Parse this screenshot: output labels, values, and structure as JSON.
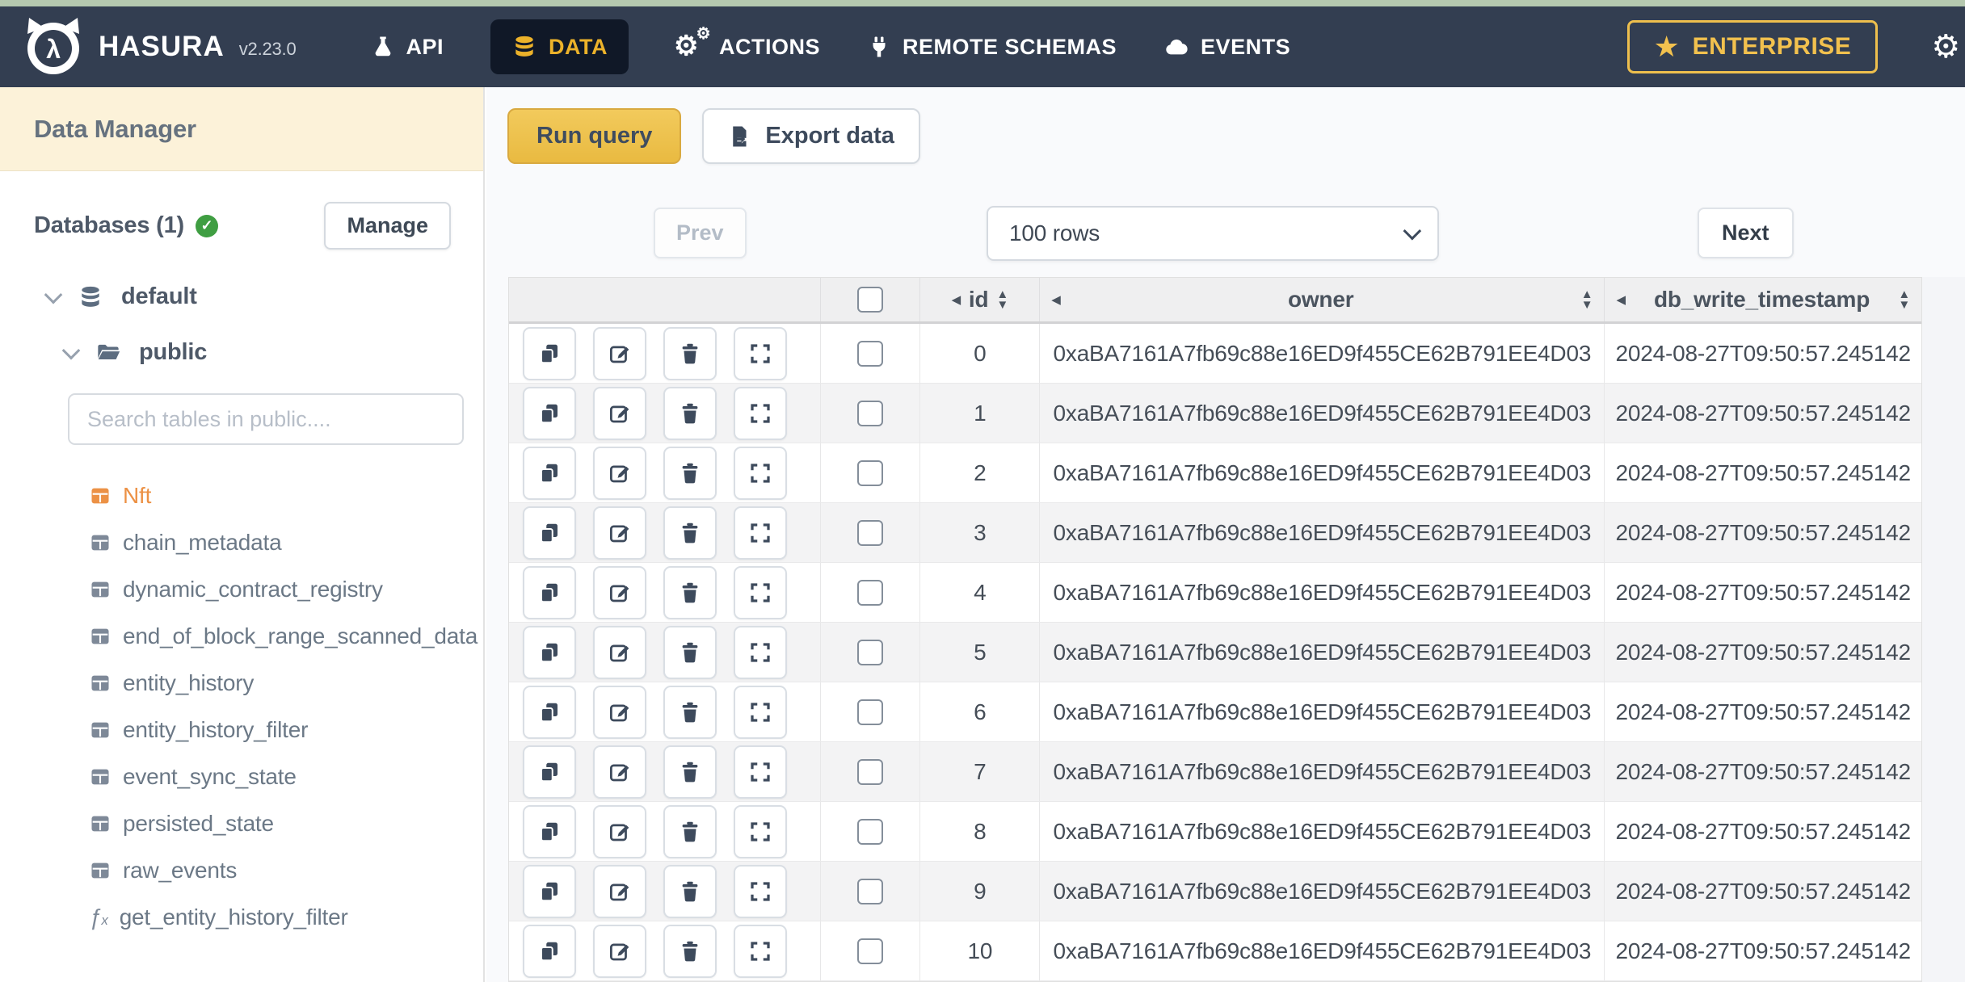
{
  "colors": {
    "top_strip_green": "#b5c8af",
    "topbar_bg": "#333e51",
    "active_tab_bg": "#101827",
    "active_tab_text": "#ecb22a",
    "enterprise_gold": "#f2c14e",
    "sidebar_header_bg": "#fcf2d9",
    "selected_table_orange": "#ec9145",
    "run_query_amber": "#eec252",
    "green_check": "#3f9e42",
    "table_stripe": "#f3f3f4"
  },
  "topbar": {
    "brand": {
      "name": "HASURA",
      "version": "v2.23.0"
    },
    "nav": [
      {
        "label": "API",
        "icon": "flask-icon",
        "active": false
      },
      {
        "label": "DATA",
        "icon": "database-icon",
        "active": true
      },
      {
        "label": "ACTIONS",
        "icon": "gears-icon",
        "active": false
      },
      {
        "label": "REMOTE SCHEMAS",
        "icon": "plug-icon",
        "active": false
      },
      {
        "label": "EVENTS",
        "icon": "cloud-icon",
        "active": false
      }
    ],
    "enterprise_label": "ENTERPRISE"
  },
  "sidebar": {
    "title": "Data Manager",
    "databases_label": "Databases (1)",
    "manage_button": "Manage",
    "tree": {
      "database": "default",
      "schema": "public"
    },
    "search_placeholder": "Search tables in public....",
    "tables": [
      {
        "name": "Nft",
        "selected": true
      },
      {
        "name": "chain_metadata",
        "selected": false
      },
      {
        "name": "dynamic_contract_registry",
        "selected": false
      },
      {
        "name": "end_of_block_range_scanned_data",
        "selected": false
      },
      {
        "name": "entity_history",
        "selected": false
      },
      {
        "name": "entity_history_filter",
        "selected": false
      },
      {
        "name": "event_sync_state",
        "selected": false
      },
      {
        "name": "persisted_state",
        "selected": false
      },
      {
        "name": "raw_events",
        "selected": false
      }
    ],
    "function_item": {
      "name": "get_entity_history_filter"
    }
  },
  "toolbar": {
    "run_query_label": "Run query",
    "export_data_label": "Export data"
  },
  "pagination": {
    "prev_label": "Prev",
    "page_size_value": "100 rows",
    "next_label": "Next"
  },
  "table": {
    "columns": [
      {
        "key": "id",
        "label": "id"
      },
      {
        "key": "owner",
        "label": "owner"
      },
      {
        "key": "db_write_timestamp",
        "label": "db_write_timestamp"
      }
    ],
    "rows": [
      {
        "id": "0",
        "owner": "0xaBA7161A7fb69c88e16ED9f455CE62B791EE4D03",
        "db_write_timestamp": "2024-08-27T09:50:57.245142"
      },
      {
        "id": "1",
        "owner": "0xaBA7161A7fb69c88e16ED9f455CE62B791EE4D03",
        "db_write_timestamp": "2024-08-27T09:50:57.245142"
      },
      {
        "id": "2",
        "owner": "0xaBA7161A7fb69c88e16ED9f455CE62B791EE4D03",
        "db_write_timestamp": "2024-08-27T09:50:57.245142"
      },
      {
        "id": "3",
        "owner": "0xaBA7161A7fb69c88e16ED9f455CE62B791EE4D03",
        "db_write_timestamp": "2024-08-27T09:50:57.245142"
      },
      {
        "id": "4",
        "owner": "0xaBA7161A7fb69c88e16ED9f455CE62B791EE4D03",
        "db_write_timestamp": "2024-08-27T09:50:57.245142"
      },
      {
        "id": "5",
        "owner": "0xaBA7161A7fb69c88e16ED9f455CE62B791EE4D03",
        "db_write_timestamp": "2024-08-27T09:50:57.245142"
      },
      {
        "id": "6",
        "owner": "0xaBA7161A7fb69c88e16ED9f455CE62B791EE4D03",
        "db_write_timestamp": "2024-08-27T09:50:57.245142"
      },
      {
        "id": "7",
        "owner": "0xaBA7161A7fb69c88e16ED9f455CE62B791EE4D03",
        "db_write_timestamp": "2024-08-27T09:50:57.245142"
      },
      {
        "id": "8",
        "owner": "0xaBA7161A7fb69c88e16ED9f455CE62B791EE4D03",
        "db_write_timestamp": "2024-08-27T09:50:57.245142"
      },
      {
        "id": "9",
        "owner": "0xaBA7161A7fb69c88e16ED9f455CE62B791EE4D03",
        "db_write_timestamp": "2024-08-27T09:50:57.245142"
      },
      {
        "id": "10",
        "owner": "0xaBA7161A7fb69c88e16ED9f455CE62B791EE4D03",
        "db_write_timestamp": "2024-08-27T09:50:57.245142"
      }
    ]
  }
}
